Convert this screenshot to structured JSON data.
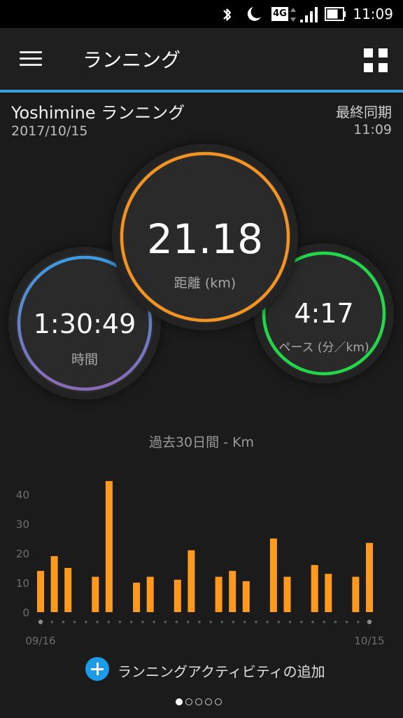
{
  "status_bar": {
    "time": "11:09",
    "network": "4G",
    "icons": [
      "bluetooth-icon",
      "moon-icon",
      "network-4g-icon",
      "signal-icon",
      "battery-icon"
    ]
  },
  "app_bar": {
    "title": "ランニング",
    "accent_color": "#3aa0dd"
  },
  "activity": {
    "title": "Yoshimine ランニング",
    "date": "2017/10/15",
    "sync_label": "最終同期",
    "sync_time": "11:09"
  },
  "stats": {
    "distance": {
      "value": "21.18",
      "label": "距離 (km)",
      "color": "#f39422"
    },
    "time": {
      "value": "1:30:49",
      "label": "時間",
      "color_top": "#3d9ae0",
      "color_bottom": "#8a6ab4"
    },
    "pace": {
      "value": "4:17",
      "label": "ペース (分／km)",
      "color": "#22d84a"
    }
  },
  "chart_data": {
    "type": "bar",
    "title": "過去30日間 - Km",
    "x_start_label": "09/16",
    "x_end_label": "10/15",
    "yticks": [
      "0",
      "10",
      "20",
      "30",
      "40"
    ],
    "ylim": [
      0,
      45
    ],
    "bar_color": "#ff9a1e",
    "days": 30,
    "values": [
      14,
      19,
      15,
      0,
      12,
      44.5,
      0,
      10,
      12,
      0,
      11,
      21,
      0,
      12,
      14,
      10.5,
      0,
      25,
      12,
      0,
      16,
      13,
      0,
      12,
      23.5
    ]
  },
  "actions": {
    "add_activity_label": "ランニングアクティビティの追加"
  },
  "pagination": {
    "count": 5,
    "active": 0
  }
}
